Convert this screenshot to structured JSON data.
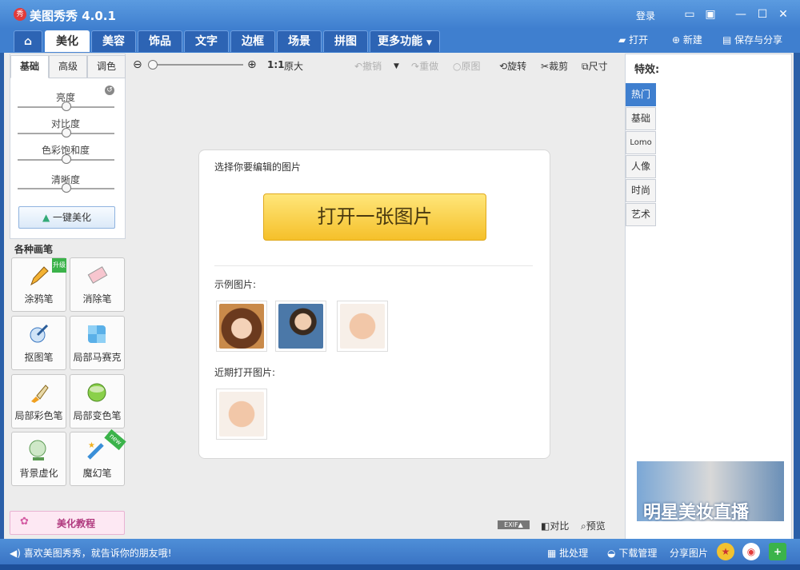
{
  "app": {
    "title": "美图秀秀 4.0.1",
    "logo": "秀"
  },
  "titlebar": {
    "login": "登录",
    "feedback_icon": "speech-bubble-icon",
    "skin_icon": "skin-icon"
  },
  "nav_tabs": [
    {
      "label": "美化",
      "active": true
    },
    {
      "label": "美容"
    },
    {
      "label": "饰品"
    },
    {
      "label": "文字"
    },
    {
      "label": "边框"
    },
    {
      "label": "场景"
    },
    {
      "label": "拼图"
    },
    {
      "label": "更多功能"
    }
  ],
  "top_actions": {
    "open": "打开",
    "new": "新建",
    "save": "保存与分享"
  },
  "sub_tabs": [
    {
      "label": "基础",
      "active": true
    },
    {
      "label": "高级"
    },
    {
      "label": "调色"
    }
  ],
  "adjust": {
    "brightness": "亮度",
    "contrast": "对比度",
    "saturation": "色彩饱和度",
    "sharpness": "清晰度",
    "one_key": "一键美化"
  },
  "brushes": {
    "title": "各种画笔",
    "items": [
      {
        "label": "涂鸦笔",
        "badge": "升级"
      },
      {
        "label": "消除笔"
      },
      {
        "label": "抠图笔"
      },
      {
        "label": "局部马赛克"
      },
      {
        "label": "局部彩色笔"
      },
      {
        "label": "局部变色笔"
      },
      {
        "label": "背景虚化"
      },
      {
        "label": "魔幻笔",
        "badge": "new"
      }
    ]
  },
  "tutorial": "美化教程",
  "toolbar": {
    "zoom_ratio": "1:1",
    "original_size": "原大",
    "undo": "撤销",
    "redo": "重做",
    "original": "原图",
    "rotate": "旋转",
    "crop": "裁剪",
    "size": "尺寸"
  },
  "card": {
    "prompt": "选择你要编辑的图片",
    "open_button": "打开一张图片",
    "examples_label": "示例图片:",
    "recent_label": "近期打开图片:"
  },
  "effects": {
    "title": "特效:",
    "tabs": [
      {
        "label": "热门",
        "active": true
      },
      {
        "label": "基础"
      },
      {
        "label": "Lomo"
      },
      {
        "label": "人像"
      },
      {
        "label": "时尚"
      },
      {
        "label": "艺术"
      }
    ]
  },
  "ad": {
    "text": "明星美妆直播"
  },
  "bottom": {
    "compare": "对比",
    "preview": "预览",
    "exif": "EXIF▲"
  },
  "status": {
    "share_msg": "喜欢美图秀秀，就告诉你的朋友哦!",
    "batch": "批处理",
    "download": "下载管理",
    "share": "分享图片"
  }
}
